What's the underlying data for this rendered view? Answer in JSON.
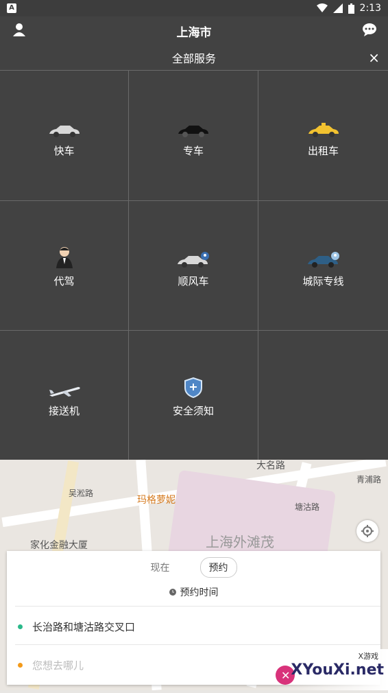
{
  "statusbar": {
    "notification": "A",
    "time": "2:13"
  },
  "header": {
    "title": "上海市"
  },
  "panel": {
    "title": "全部服务",
    "close": "×",
    "services": [
      {
        "label": "快车",
        "icon": "car-silver-icon"
      },
      {
        "label": "专车",
        "icon": "car-black-icon"
      },
      {
        "label": "出租车",
        "icon": "taxi-icon"
      },
      {
        "label": "代驾",
        "icon": "chauffeur-icon"
      },
      {
        "label": "顺风车",
        "icon": "carpool-icon"
      },
      {
        "label": "城际专线",
        "icon": "intercity-car-icon"
      },
      {
        "label": "接送机",
        "icon": "airplane-icon"
      },
      {
        "label": "安全须知",
        "icon": "shield-icon"
      },
      {
        "label": "",
        "icon": ""
      }
    ]
  },
  "map": {
    "labels": [
      "大名路",
      "玛格萝妮",
      "家化金融大厦",
      "上海外滩茂",
      "青浦路",
      "吴淞路",
      "塘沽路"
    ]
  },
  "booking": {
    "tab_now": "现在",
    "tab_reserve": "预约",
    "time_label": "预约时间",
    "pickup": "长治路和塘沽路交叉口",
    "destination_placeholder": "您想去哪儿"
  },
  "watermark": {
    "brand": "XYouXi.net",
    "tag": "X游戏"
  },
  "colors": {
    "header": "#424242",
    "pickup_dot": "#2bb98a",
    "dest_dot": "#f39a1a"
  }
}
